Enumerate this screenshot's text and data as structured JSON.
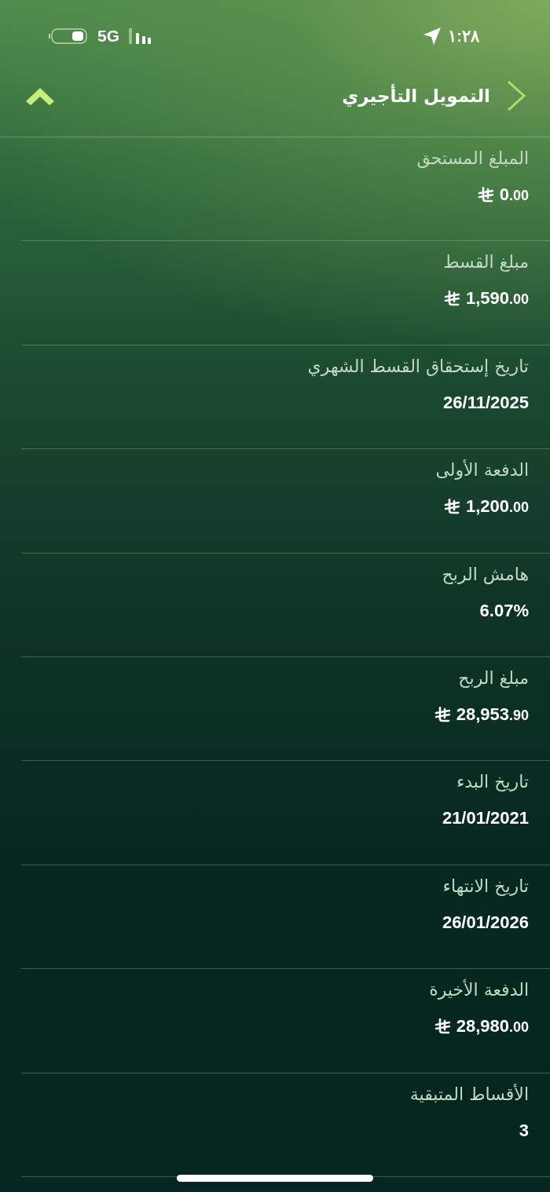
{
  "status_bar": {
    "time": "١:٢٨",
    "network": "5G"
  },
  "header": {
    "title": "التمويل التأجيري"
  },
  "fields": [
    {
      "label": "المبلغ المستحق",
      "kind": "money",
      "amount": "0",
      "decimals": ".00"
    },
    {
      "label": "مبلغ القسط",
      "kind": "money",
      "amount": "1,590",
      "decimals": ".00"
    },
    {
      "label": "تاريخ إستحقاق القسط الشهري",
      "kind": "text",
      "value": "26/11/2025"
    },
    {
      "label": "الدفعة الأولى",
      "kind": "money",
      "amount": "1,200",
      "decimals": ".00"
    },
    {
      "label": "هامش الربح",
      "kind": "text",
      "value": "6.07%"
    },
    {
      "label": "مبلغ الربح",
      "kind": "money",
      "amount": "28,953",
      "decimals": ".90"
    },
    {
      "label": "تاريخ البدء",
      "kind": "text",
      "value": "21/01/2021"
    },
    {
      "label": "تاريخ الانتهاء",
      "kind": "text",
      "value": "26/01/2026"
    },
    {
      "label": "الدفعة الأخيرة",
      "kind": "money",
      "amount": "28,980",
      "decimals": ".00"
    },
    {
      "label": "الأقساط المتبقية",
      "kind": "text",
      "value": "3"
    }
  ]
}
